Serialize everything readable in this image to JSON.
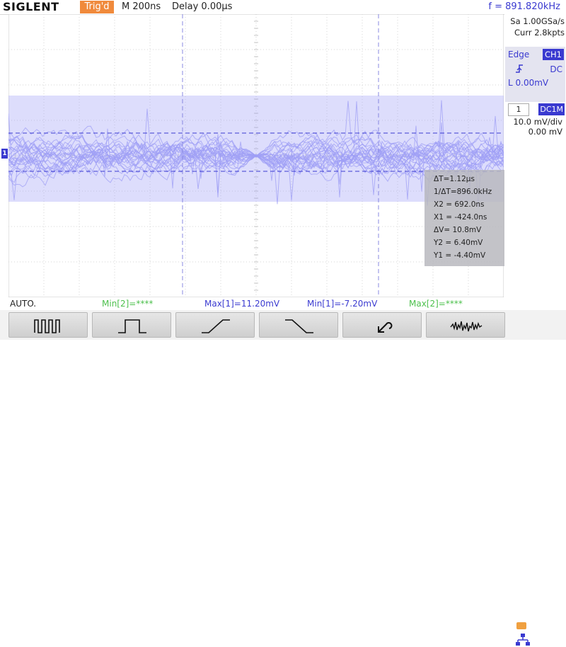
{
  "header": {
    "brand": "SIGLENT",
    "trigger_status": "Trig'd",
    "timebase": "M 200ns",
    "delay": "Delay 0.00μs",
    "frequency": "f = 891.820kHz"
  },
  "acquisition": {
    "sample_rate": "Sa 1.00GSa/s",
    "memory_depth": "Curr 2.8kpts"
  },
  "trigger_panel": {
    "type": "Edge",
    "source": "CH1",
    "slope_icon": "rising-edge-icon",
    "coupling": "DC",
    "level": "L  0.00mV"
  },
  "channel_panel": {
    "channel": "1",
    "coupling": "DC1M",
    "scale": "10.0 mV/div",
    "offset": "0.00 mV"
  },
  "waveform": {
    "channel_marker": "1",
    "color": "#9f9ff5"
  },
  "cursors": {
    "delta_t": "ΔT=1.12μs",
    "inv_delta_t": "1/ΔT=896.0kHz",
    "x2": "X2 = 692.0ns",
    "x1": "X1 = -424.0ns",
    "delta_v": "ΔV= 10.8mV",
    "y2": "Y2 = 6.40mV",
    "y1": "Y1 = -4.40mV"
  },
  "measurement_bar": {
    "mode": "AUTO.",
    "min2": "Min[2]=****",
    "max1": "Max[1]=11.20mV",
    "min1": "Min[1]=-7.20mV",
    "max2": "Max[2]=****"
  },
  "softkeys": [
    {
      "icon": "pulse-train-icon"
    },
    {
      "icon": "single-pulse-icon"
    },
    {
      "icon": "rising-edge-icon"
    },
    {
      "icon": "falling-edge-icon"
    },
    {
      "icon": "return-icon"
    },
    {
      "icon": "noise-waveform-icon"
    }
  ],
  "colors": {
    "accent": "#3a3ad0",
    "trigger": "#f08a3c",
    "measure_green": "#4cc04c"
  }
}
